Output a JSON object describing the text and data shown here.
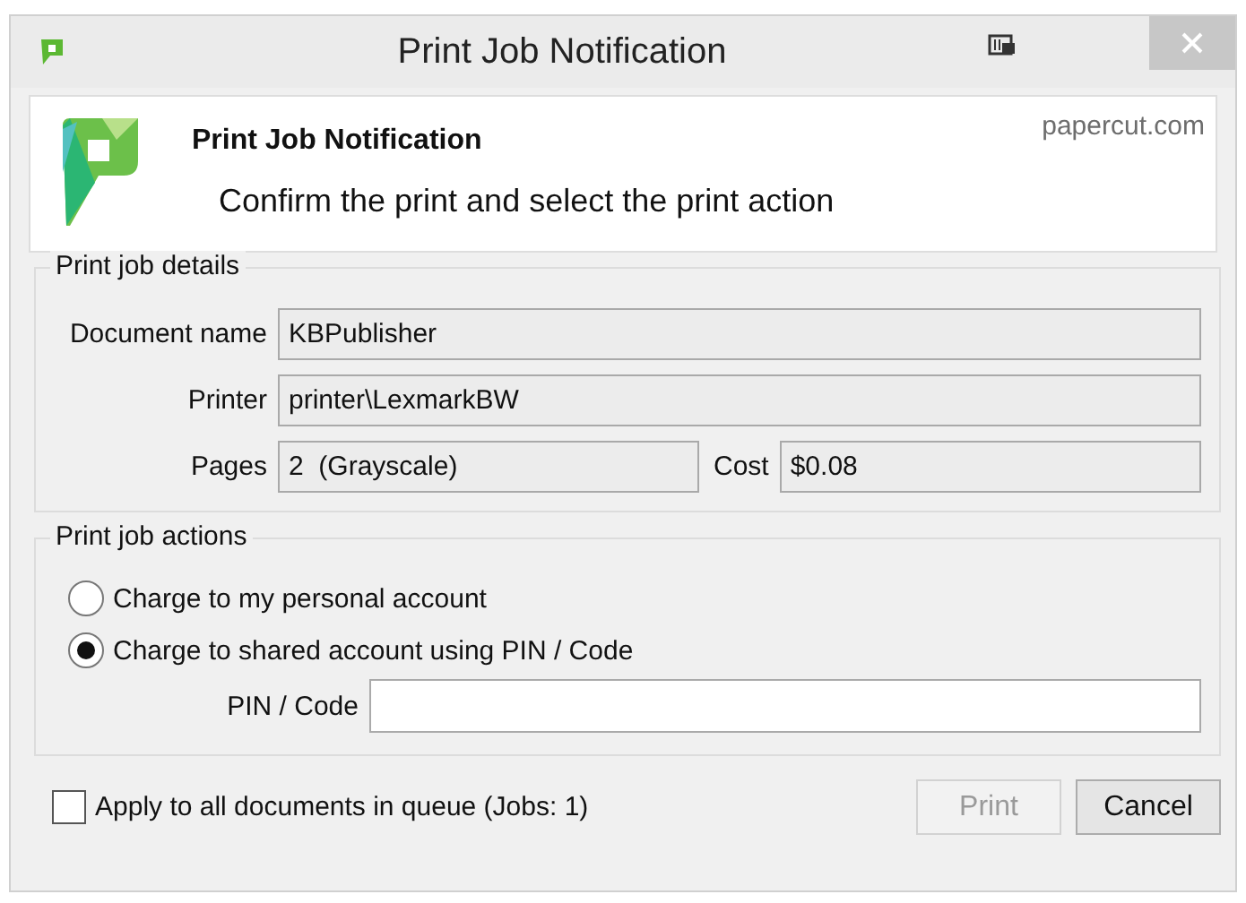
{
  "window": {
    "title": "Print Job Notification"
  },
  "header": {
    "title": "Print Job Notification",
    "subtitle": "Confirm the print and select the print action",
    "link": "papercut.com"
  },
  "details": {
    "legend": "Print job details",
    "fields": [
      {
        "label": "Document name",
        "value": "KBPublisher"
      },
      {
        "label": "Printer",
        "value": "printer\\LexmarkBW"
      }
    ],
    "pages": {
      "label": "Pages",
      "value": "2  (Grayscale)"
    },
    "cost": {
      "label": "Cost",
      "value": "$0.08"
    }
  },
  "actions": {
    "legend": "Print job actions",
    "options": [
      {
        "label": "Charge to my personal account",
        "selected": false
      },
      {
        "label": "Charge to shared account using PIN / Code",
        "selected": true
      }
    ],
    "pin": {
      "label": "PIN / Code"
    }
  },
  "apply": {
    "label": "Apply to all documents in queue (Jobs: 1)",
    "checked": false
  },
  "buttons": [
    {
      "label": "Print",
      "disabled": true
    },
    {
      "label": "Cancel",
      "disabled": false
    }
  ]
}
